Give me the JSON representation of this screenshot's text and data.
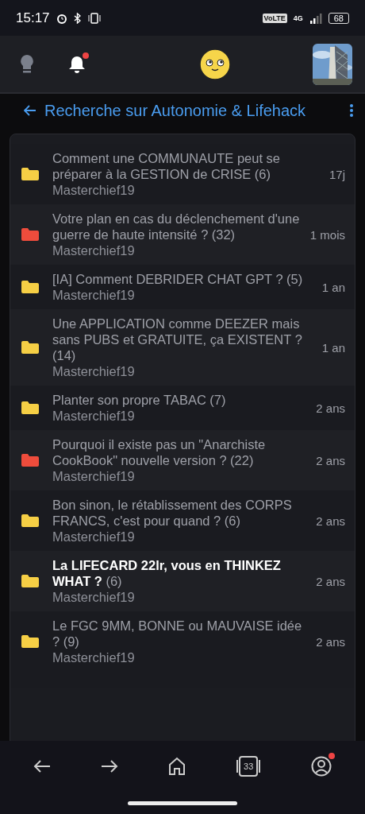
{
  "status_bar": {
    "time": "15:17",
    "network": "4G",
    "volte": "VoLTE",
    "battery": "68"
  },
  "header": {
    "notification_badge": true
  },
  "title_bar": {
    "title": "Recherche sur Autonomie & Lifehack"
  },
  "topics": [
    {
      "title": "Comment une COMMUNAUTE peut se préparer à la GESTION de CRISE",
      "count": "(6)",
      "author": "Masterchief19",
      "age": "17j",
      "color": "#f6cf45",
      "unread": false
    },
    {
      "title": "Votre plan en cas du déclenchement d'une guerre de haute intensité ?",
      "count": "(32)",
      "author": "Masterchief19",
      "age": "1 mois",
      "color": "#ee4c3c",
      "unread": false
    },
    {
      "title": "[IA] Comment DEBRIDER CHAT GPT ?",
      "count": "(5)",
      "author": "Masterchief19",
      "age": "1 an",
      "color": "#f6cf45",
      "unread": false
    },
    {
      "title": "Une APPLICATION comme DEEZER mais sans PUBS et GRATUITE, ça EXISTENT ?",
      "count": "(14)",
      "author": "Masterchief19",
      "age": "1 an",
      "color": "#f6cf45",
      "unread": false
    },
    {
      "title": "Planter son propre TABAC",
      "count": "(7)",
      "author": "Masterchief19",
      "age": "2 ans",
      "color": "#f6cf45",
      "unread": false
    },
    {
      "title": "Pourquoi il existe pas un \"Anarchiste CookBook\" nouvelle version ?",
      "count": "(22)",
      "author": "Masterchief19",
      "age": "2 ans",
      "color": "#ee4c3c",
      "unread": false
    },
    {
      "title": "Bon sinon, le rétablissement des CORPS FRANCS, c'est pour quand ?",
      "count": "(6)",
      "author": "Masterchief19",
      "age": "2 ans",
      "color": "#f6cf45",
      "unread": false
    },
    {
      "title": "La LIFECARD 22lr, vous en THINKEZ WHAT ?",
      "count": "(6)",
      "author": "Masterchief19",
      "age": "2 ans",
      "color": "#f6cf45",
      "unread": true
    },
    {
      "title": "Le FGC 9MM, BONNE ou MAUVAISE idée ?",
      "count": "(9)",
      "author": "Masterchief19",
      "age": "2 ans",
      "color": "#f6cf45",
      "unread": false
    }
  ],
  "bottom_nav": {
    "tabs_count": "33",
    "profile_badge": true
  }
}
